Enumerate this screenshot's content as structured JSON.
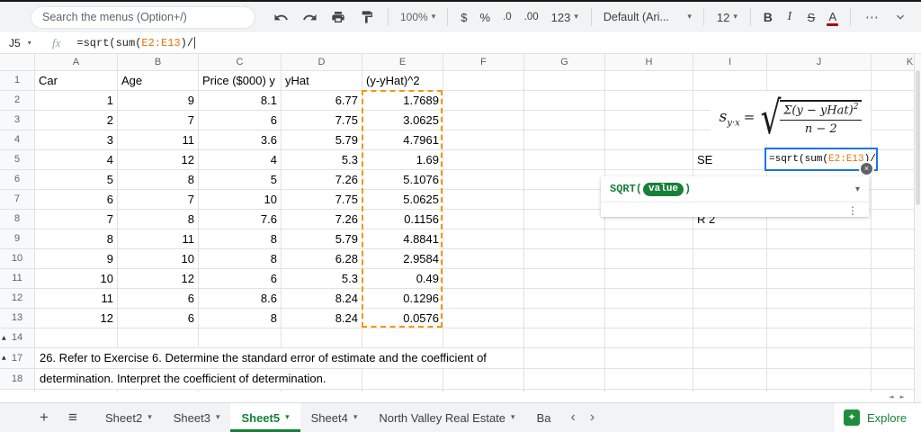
{
  "colors": {
    "formula_range_text": "#e8710a",
    "range_dash": "#f29900",
    "editing_border": "#1a73e8",
    "function_green": "#188038",
    "active_tab_green": "#188038",
    "text_color_indicator": "#b10000",
    "explore_green": "#1e8e3e"
  },
  "icons": {
    "caret_down": "▾",
    "name_box_caret": "▾",
    "more_vertical": "⋮",
    "close": "×",
    "collapse_marker": "▲",
    "scroll_left": "◄",
    "scroll_right": "►",
    "tab_nav_left": "‹",
    "tab_nav_right": "›",
    "add_sheet": "+",
    "all_sheets": "≡",
    "explore_star": "✦"
  },
  "toolbar": {
    "search_text": "Search the menus (Option+/)",
    "zoom": "100%",
    "currency": "$",
    "percent": "%",
    "decimal_decrease": ".0",
    "decimal_increase": ".00",
    "number_format": "123",
    "font_name": "Default (Ari...",
    "font_size": "12",
    "bold": "B",
    "italic": "I",
    "strikethrough": "S",
    "text_color": "A",
    "more": "⋯"
  },
  "formula_bar": {
    "cell_ref": "J5",
    "fx_label": "fx",
    "formula": {
      "pre": "=sqrt(sum(",
      "range": "E2:E13",
      "post": ")/"
    }
  },
  "grid": {
    "col_letters": [
      "A",
      "B",
      "C",
      "D",
      "E",
      "F",
      "G",
      "H",
      "I",
      "J",
      "K"
    ],
    "row_labels": [
      "1",
      "2",
      "3",
      "4",
      "5",
      "6",
      "7",
      "8",
      "9",
      "10",
      "11",
      "12",
      "13",
      "14",
      "17",
      "18"
    ],
    "collapse_marker_rows": [
      "14",
      "17"
    ],
    "header_row": [
      "Car",
      "Age",
      "Price ($000) y",
      "yHat",
      "(y-yHat)^2"
    ],
    "body_rows": [
      [
        "1",
        "9",
        "8.1",
        "6.77",
        "1.7689"
      ],
      [
        "2",
        "7",
        "6",
        "7.75",
        "3.0625"
      ],
      [
        "3",
        "11",
        "3.6",
        "5.79",
        "4.7961"
      ],
      [
        "4",
        "12",
        "4",
        "5.3",
        "1.69"
      ],
      [
        "5",
        "8",
        "5",
        "7.26",
        "5.1076"
      ],
      [
        "6",
        "7",
        "10",
        "7.75",
        "5.0625"
      ],
      [
        "7",
        "8",
        "7.6",
        "7.26",
        "0.1156"
      ],
      [
        "8",
        "11",
        "8",
        "5.79",
        "4.8841"
      ],
      [
        "9",
        "10",
        "8",
        "6.28",
        "2.9584"
      ],
      [
        "10",
        "12",
        "6",
        "5.3",
        "0.49"
      ],
      [
        "11",
        "6",
        "8.6",
        "8.24",
        "0.1296"
      ],
      [
        "12",
        "6",
        "8",
        "8.24",
        "0.0576"
      ]
    ],
    "extra_cells": [
      {
        "row": "5",
        "col": "I",
        "value": "SE",
        "align": "left"
      },
      {
        "row": "8",
        "col": "I",
        "value": "R 2",
        "align": "left"
      },
      {
        "row": "17",
        "col": "A",
        "value": "26. Refer to Exercise 6. Determine the standard error of estimate and the coefficient of",
        "align": "left",
        "overflow": true
      },
      {
        "row": "18",
        "col": "A",
        "value": "determination. Interpret the coefficient of determination.",
        "align": "left",
        "overflow": true
      }
    ]
  },
  "formula_note": {
    "lhs_base": "s",
    "lhs_sub": "y·x",
    "equals": "=",
    "radical": "√",
    "numerator": "Σ(y − yHat)",
    "numerator_exp": "2",
    "denominator": "n − 2"
  },
  "function_help": {
    "name": "SQRT(",
    "arg": "value",
    "close_paren": ")"
  },
  "sheet_bar": {
    "tabs": [
      {
        "label": "Sheet2",
        "active": false
      },
      {
        "label": "Sheet3",
        "active": false
      },
      {
        "label": "Sheet5",
        "active": true
      },
      {
        "label": "Sheet4",
        "active": false
      },
      {
        "label": "North Valley Real Estate",
        "active": false
      },
      {
        "label": "Ba",
        "active": false,
        "truncated": true
      }
    ],
    "explore_label": "Explore"
  }
}
